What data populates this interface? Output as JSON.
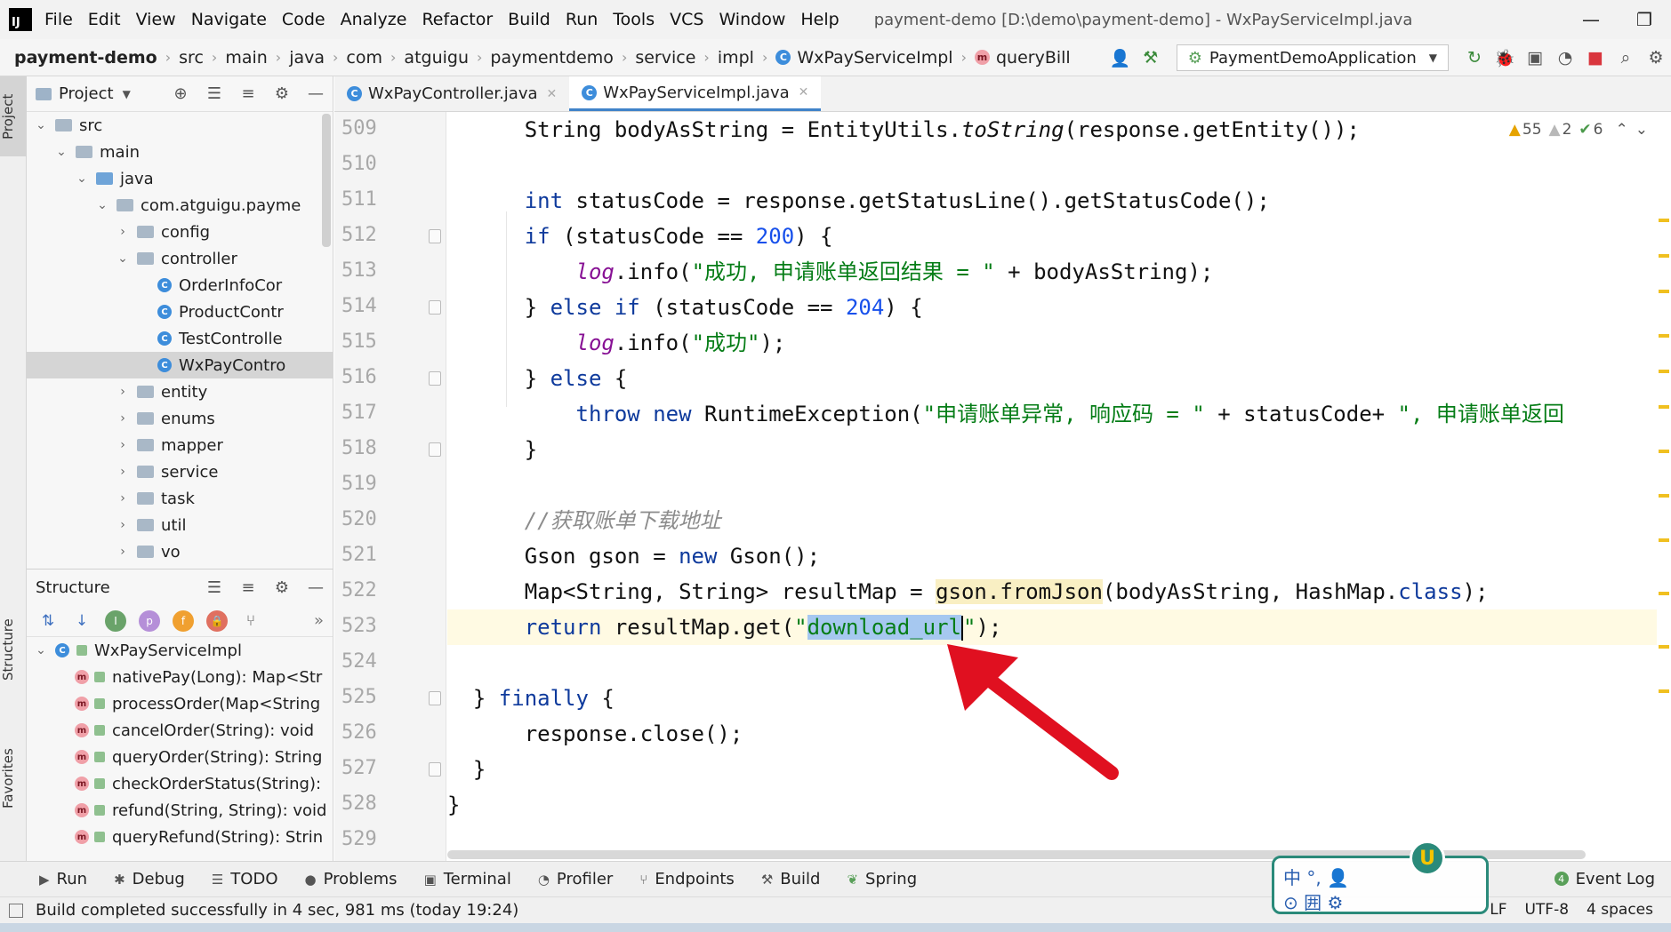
{
  "app": {
    "logo": "IJ",
    "window_title": "payment-demo [D:\\demo\\payment-demo] - WxPayServiceImpl.java",
    "menu": [
      "File",
      "Edit",
      "View",
      "Navigate",
      "Code",
      "Analyze",
      "Refactor",
      "Build",
      "Run",
      "Tools",
      "VCS",
      "Window",
      "Help"
    ]
  },
  "breadcrumb": {
    "project": "payment-demo",
    "items": [
      "src",
      "main",
      "java",
      "com",
      "atguigu",
      "paymentdemo",
      "service",
      "impl"
    ],
    "class_name": "WxPayServiceImpl",
    "method_name": "queryBill"
  },
  "toolbar": {
    "run_config": "PaymentDemoApplication"
  },
  "left_stripe": {
    "project": "Project",
    "structure": "Structure",
    "favorites": "Favorites"
  },
  "project_panel": {
    "title": "Project",
    "tree": [
      {
        "label": "src",
        "indent": 1,
        "chevron": "v",
        "icon": "folder"
      },
      {
        "label": "main",
        "indent": 2,
        "chevron": "v",
        "icon": "folder"
      },
      {
        "label": "java",
        "indent": 3,
        "chevron": "v",
        "icon": "folder-blue"
      },
      {
        "label": "com.atguigu.payme",
        "indent": 4,
        "chevron": "v",
        "icon": "folder"
      },
      {
        "label": "config",
        "indent": 5,
        "chevron": ">",
        "icon": "folder"
      },
      {
        "label": "controller",
        "indent": 5,
        "chevron": "v",
        "icon": "folder"
      },
      {
        "label": "OrderInfoCor",
        "indent": 6,
        "chevron": "",
        "icon": "class"
      },
      {
        "label": "ProductContr",
        "indent": 6,
        "chevron": "",
        "icon": "class"
      },
      {
        "label": "TestControlle",
        "indent": 6,
        "chevron": "",
        "icon": "class"
      },
      {
        "label": "WxPayContro",
        "indent": 6,
        "chevron": "",
        "icon": "class",
        "selected": true
      },
      {
        "label": "entity",
        "indent": 5,
        "chevron": ">",
        "icon": "folder"
      },
      {
        "label": "enums",
        "indent": 5,
        "chevron": ">",
        "icon": "folder"
      },
      {
        "label": "mapper",
        "indent": 5,
        "chevron": ">",
        "icon": "folder"
      },
      {
        "label": "service",
        "indent": 5,
        "chevron": ">",
        "icon": "folder"
      },
      {
        "label": "task",
        "indent": 5,
        "chevron": ">",
        "icon": "folder"
      },
      {
        "label": "util",
        "indent": 5,
        "chevron": ">",
        "icon": "folder"
      },
      {
        "label": "vo",
        "indent": 5,
        "chevron": ">",
        "icon": "folder"
      }
    ]
  },
  "structure_panel": {
    "title": "Structure",
    "root": "WxPayServiceImpl",
    "methods": [
      "nativePay(Long): Map<Str",
      "processOrder(Map<String",
      "cancelOrder(String): void",
      "queryOrder(String): String",
      "checkOrderStatus(String):",
      "refund(String, String): void",
      "queryRefund(String): Strin"
    ]
  },
  "editor": {
    "tabs": [
      {
        "label": "WxPayController.java",
        "active": false
      },
      {
        "label": "WxPayServiceImpl.java",
        "active": true
      }
    ],
    "inspections": {
      "warnings": "55",
      "weak_warnings": "2",
      "typos": "6"
    },
    "line_numbers": [
      "509",
      "510",
      "511",
      "512",
      "513",
      "514",
      "515",
      "516",
      "517",
      "518",
      "519",
      "520",
      "521",
      "522",
      "523",
      "524",
      "525",
      "526",
      "527",
      "528",
      "529"
    ]
  },
  "bottom_tools": [
    "Run",
    "Debug",
    "TODO",
    "Problems",
    "Terminal",
    "Profiler",
    "Endpoints",
    "Build",
    "Spring"
  ],
  "event_log": {
    "count": "4",
    "label": "Event Log"
  },
  "status": {
    "message": "Build completed successfully in 4 sec, 981 ms (today 19:24)",
    "line_sep": "LF",
    "encoding": "UTF-8",
    "indent": "4 spaces"
  },
  "ime": {
    "line1": "中 °, 👤",
    "line2": "⊙ 囲 ⚙"
  }
}
